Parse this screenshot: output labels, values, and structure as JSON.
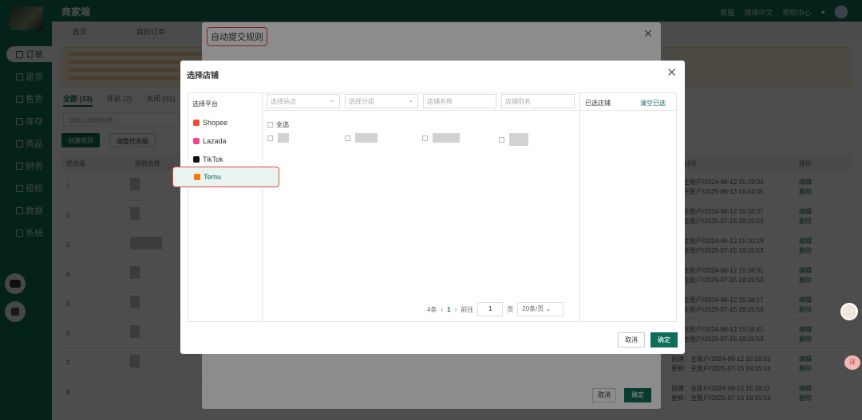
{
  "app": {
    "brand": "商家端"
  },
  "topbar": {
    "service": "客服",
    "language": "简体中文",
    "help": "帮助中心"
  },
  "nav": [
    {
      "label": "订单"
    },
    {
      "label": "退货"
    },
    {
      "label": "售货"
    },
    {
      "label": "库存"
    },
    {
      "label": "商品"
    },
    {
      "label": "财务"
    },
    {
      "label": "授权"
    },
    {
      "label": "数据"
    },
    {
      "label": "系统"
    }
  ],
  "page_tabs": {
    "home": "首页",
    "my_orders": "我的订单"
  },
  "subtabs": {
    "all": "全部 (33)",
    "on": "开启 (2)",
    "off": "关闭 (31)"
  },
  "search_placeholder": "请输入规则名称",
  "buttons": {
    "create": "创建规则",
    "adjust": "调整优先级"
  },
  "table_head": {
    "priority": "优先级",
    "rule_name": "规则名称",
    "time": "时间",
    "action": "操作"
  },
  "rows": [
    {
      "n": "1",
      "t1": "主账户/2024-06-12 15:19:04",
      "t2": "主账户/2025-08-13 16:54:05"
    },
    {
      "n": "2",
      "t1": "主账户/2024-06-12 15:18:37",
      "t2": "主账户/2025-07-15 19:15:53"
    },
    {
      "n": "3",
      "t1": "主账户/2024-06-12 15:10:19",
      "t2": "主账户/2025-07-15 19:15:53"
    },
    {
      "n": "4",
      "t1": "主账户/2024-06-12 15:18:31",
      "t2": "主账户/2025-07-15 19:15:53"
    },
    {
      "n": "5",
      "t1": "主账户/2024-06-12 15:18:17",
      "t2": "主账户/2025-07-15 19:15:53"
    },
    {
      "n": "6",
      "t1": "主账户/2024-06-12 15:18:41",
      "t2": "主账户/2025-07-15 19:15:53"
    },
    {
      "n": "7",
      "t1": "创建：主账户/2024-06-12 15:18:51",
      "t2": "更新：主账户/2025-07-15 19:15:53"
    },
    {
      "n": "8",
      "t1": "创建：主账户/2024-06-12 15:18:11",
      "t2": "更新：主账户/2025-07-15 19:15:53"
    }
  ],
  "row_actions": {
    "edit": "编辑",
    "delete": "删除"
  },
  "mid_modal": {
    "title": "自动提交规则",
    "cancel": "取消",
    "ok": "确定"
  },
  "modal": {
    "title": "选择店铺",
    "platform_head": "选择平台",
    "platforms": [
      {
        "label": "Shopee",
        "color": "#ee4d2d"
      },
      {
        "label": "Lazada",
        "color": "#f5448a"
      },
      {
        "label": "TikTok",
        "color": "#111111"
      },
      {
        "label": "Temu",
        "color": "#fb7701"
      }
    ],
    "filters": {
      "site": "选择站点",
      "group": "选择分组",
      "store_name": "店铺名称",
      "store_alias": "店铺别名"
    },
    "check_all": "全选",
    "selected_head": "已选店铺",
    "clear_selected": "清空已选",
    "pager": {
      "total": "4条",
      "page": "1",
      "goto": "前往",
      "goto_value": "1",
      "page_unit": "页",
      "per_page": "20条/页"
    },
    "cancel": "取消",
    "ok": "确定"
  },
  "colors": {
    "brand": "#0f6e5a",
    "highlight": "#e44a3a"
  }
}
